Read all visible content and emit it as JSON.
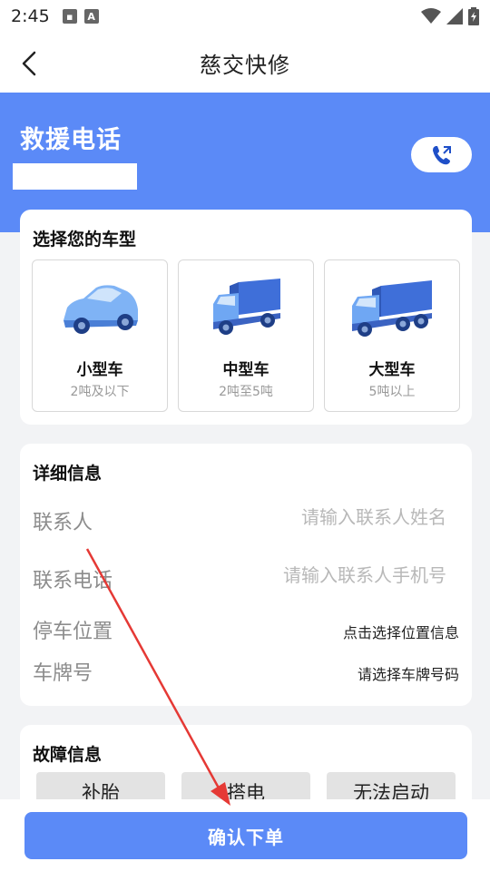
{
  "status_bar": {
    "time": "2:45",
    "icons": [
      "image-icon",
      "a-icon",
      "wifi-icon",
      "signal-icon",
      "battery-icon"
    ]
  },
  "nav": {
    "title": "慈交快修",
    "back_icon": "back-arrow-icon"
  },
  "hero": {
    "title": "救援电话",
    "background_color": "#5b8af7",
    "call_icon": "phone-call-icon"
  },
  "vehicle": {
    "title": "选择您的车型",
    "options": [
      {
        "name": "小型车",
        "desc": "2吨及以下",
        "icon": "car-icon"
      },
      {
        "name": "中型车",
        "desc": "2吨至5吨",
        "icon": "medium-truck-icon"
      },
      {
        "name": "大型车",
        "desc": "5吨以上",
        "icon": "large-truck-icon"
      }
    ]
  },
  "details": {
    "title": "详细信息",
    "contact_label": "联系人",
    "contact_placeholder": "请输入联系人姓名",
    "phone_label": "联系电话",
    "phone_placeholder": "请输入联系人手机号",
    "location_label": "停车位置",
    "location_value": "点击选择位置信息",
    "plate_label": "车牌号",
    "plate_value": "请选择车牌号码"
  },
  "fault": {
    "title": "故障信息",
    "options": [
      "补胎",
      "搭电",
      "无法启动"
    ]
  },
  "footer": {
    "confirm_label": "确认下单",
    "accent_color": "#5b8af7"
  },
  "annotation": {
    "type": "red-arrow",
    "color": "#e53935"
  }
}
